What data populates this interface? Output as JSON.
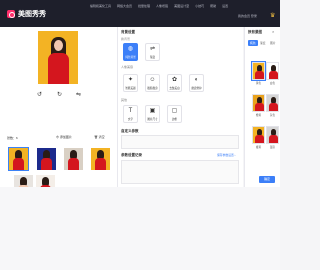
{
  "app": {
    "name": "美图秀秀"
  },
  "titlebar": {
    "menu": [
      "编辑和美化工具",
      "网络大会员",
      "批量处理",
      "人像增强",
      "美图设计室",
      "小技巧",
      "帮助",
      "设置"
    ],
    "user": "我的会员",
    "user_name": "登录"
  },
  "left": {
    "photo_count": "张数：6",
    "add_label": "添加图片",
    "clear_label": "清空",
    "thumb_colors": [
      "#f3b324",
      "#1c2a8c",
      "#d9d0c4",
      "#f3b324",
      "#e8e4e0",
      "#f4eee8"
    ],
    "thumb_body_colors": [
      "#d4161e",
      "#d4161e",
      "#d4161e",
      "#d4161e",
      "#f2c8b0",
      "#d4161e"
    ]
  },
  "mid": {
    "section_title": "背景设置",
    "subsection_label": "换背景",
    "bg_tools": [
      {
        "icon": "color-icon",
        "glyph": "◍",
        "label": "纯色背景"
      },
      {
        "icon": "gradient-icon",
        "glyph": "⇌",
        "label": "渐变"
      }
    ],
    "portrait_label": "人像美容",
    "portrait_tools": [
      {
        "icon": "magic-wand-icon",
        "glyph": "✦",
        "label": "智能美颜"
      },
      {
        "icon": "face-icon",
        "glyph": "☺",
        "label": "瘦脸瘦身"
      },
      {
        "icon": "skin-icon",
        "glyph": "✿",
        "label": "去皱美白"
      },
      {
        "icon": "retouch-icon",
        "glyph": "◐",
        "label": "磨皮修护"
      }
    ],
    "text_label": "其他",
    "text_tools": [
      {
        "icon": "text-icon",
        "glyph": "T",
        "label": "文字"
      },
      {
        "icon": "resize-icon",
        "glyph": "▣",
        "label": "图片尺寸"
      },
      {
        "icon": "border-icon",
        "glyph": "▢",
        "label": "边框"
      }
    ],
    "custom_title": "自定义参数",
    "history_title": "参数设置记录",
    "history_link": "保存参数设置 ›"
  },
  "right": {
    "title": "换背景图",
    "close": "×",
    "tabs": [
      "纯色",
      "渐变",
      "图片"
    ],
    "swatches": [
      {
        "color": "#f3b324",
        "label": "黄色"
      },
      {
        "color": "#ffffff",
        "label": "白色"
      },
      {
        "color": "#e9a21d",
        "label": "橙黄"
      },
      {
        "color": "#d6d6d6",
        "label": "灰色"
      },
      {
        "color": "#f3b324",
        "label": "暖黄"
      },
      {
        "color": "#d6d6d6",
        "label": "银灰"
      }
    ],
    "apply": "确定"
  }
}
